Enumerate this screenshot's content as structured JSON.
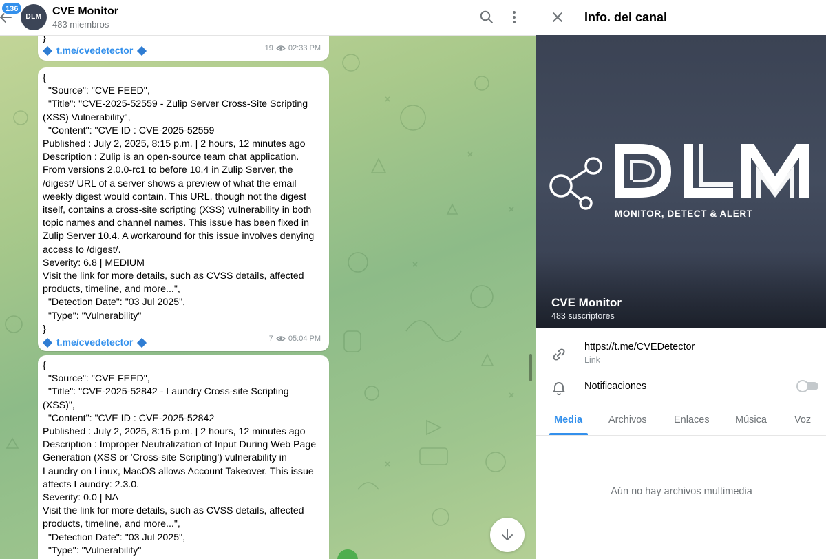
{
  "chat": {
    "unread_count": "136",
    "avatar_text": "DLM",
    "title": "CVE Monitor",
    "subtitle": "483 miembros",
    "messages": [
      {
        "text": "}",
        "link": "t.me/cvedetector",
        "views": "19",
        "time": "02:33 PM"
      },
      {
        "text": "{\n  \"Source\": \"CVE FEED\",\n  \"Title\": \"CVE-2025-52559 - Zulip Server Cross-Site Scripting\n(XSS) Vulnerability\",\n  \"Content\": \"CVE ID : CVE-2025-52559\nPublished : July 2, 2025, 8:15 p.m. | 2 hours, 12 minutes ago\nDescription : Zulip is an open-source team chat application.\nFrom versions 2.0.0-rc1 to before 10.4 in Zulip Server, the\n/digest/ URL of a server shows a preview of what the email\nweekly digest would contain. This URL, though not the digest\nitself, contains a cross-site scripting (XSS) vulnerability in both\ntopic names and channel names. This issue has been fixed in\nZulip Server 10.4. A workaround for this issue involves denying\naccess to /digest/.\nSeverity: 6.8 | MEDIUM\nVisit the link for more details, such as CVSS details, affected\nproducts, timeline, and more...\",\n  \"Detection Date\": \"03 Jul 2025\",\n  \"Type\": \"Vulnerability\"\n}",
        "link": "t.me/cvedetector",
        "views": "7",
        "time": "05:04 PM"
      },
      {
        "text": "{\n  \"Source\": \"CVE FEED\",\n  \"Title\": \"CVE-2025-52842 - Laundry Cross-site Scripting (XSS)\",\n  \"Content\": \"CVE ID : CVE-2025-52842\nPublished : July 2, 2025, 8:15 p.m. | 2 hours, 12 minutes ago\nDescription : Improper Neutralization of Input During Web Page\nGeneration (XSS or 'Cross-site Scripting') vulnerability in\nLaundry on Linux, MacOS allows Account Takeover. This issue\naffects Laundry: 2.3.0.\nSeverity: 0.0 | NA\nVisit the link for more details, such as CVSS details, affected\nproducts, timeline, and more...\",\n  \"Detection Date\": \"03 Jul 2025\",\n  \"Type\": \"Vulnerability\"\n}"
      }
    ]
  },
  "panel": {
    "title": "Info. del canal",
    "cover": {
      "tagline": "MONITOR, DETECT & ALERT",
      "name": "CVE Monitor",
      "subscribers": "483 suscriptores"
    },
    "link": {
      "value": "https://t.me/CVEDetector",
      "caption": "Link"
    },
    "notifications": {
      "label": "Notificaciones",
      "enabled": false
    },
    "tabs": [
      "Media",
      "Archivos",
      "Enlaces",
      "Música",
      "Voz"
    ],
    "active_tab": "Media",
    "empty_text": "Aún no hay archivos multimedia"
  },
  "colors": {
    "accent": "#3390ec",
    "link_diamond": "#2f7dd3",
    "cover_bg": "#434c5e",
    "chat_bg": "#a9c98b"
  }
}
